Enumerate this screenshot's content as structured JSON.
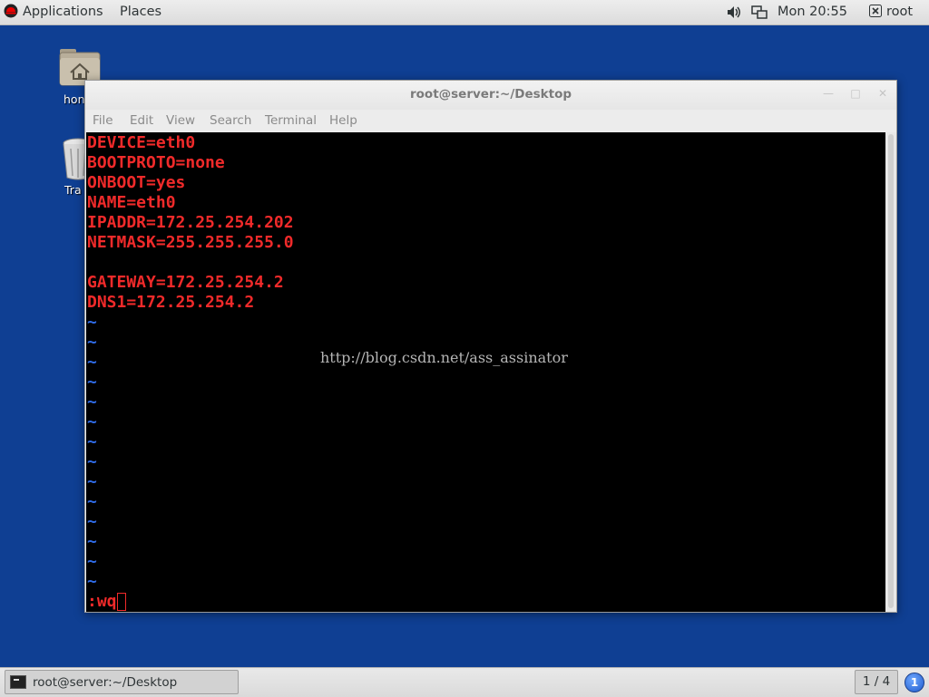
{
  "top_panel": {
    "applications_label": "Applications",
    "places_label": "Places",
    "clock": "Mon 20:55",
    "user": "root"
  },
  "desktop": {
    "home_label": "hon",
    "trash_label": "Tra"
  },
  "terminal": {
    "title": "root@server:~/Desktop",
    "menu": [
      "File",
      "Edit",
      "View",
      "Search",
      "Terminal",
      "Help"
    ],
    "lines": [
      "DEVICE=eth0",
      "BOOTPROTO=none",
      "ONBOOT=yes",
      "NAME=eth0",
      "IPADDR=172.25.254.202",
      "NETMASK=255.255.255.0",
      "",
      "GATEWAY=172.25.254.2",
      "DNS1=172.25.254.2"
    ],
    "tilde": "~",
    "command_line": ":wq",
    "watermark": "http://blog.csdn.net/ass_assinator"
  },
  "bottom_panel": {
    "task_label": "root@server:~/Desktop",
    "workspace": "1 / 4",
    "notification_count": "1"
  },
  "colors": {
    "desktop_bg": "#0f3f93",
    "terminal_text": "#f02a2a",
    "tilde": "#2f6be6"
  },
  "icons": [
    "redhat-logo-icon",
    "volume-icon",
    "network-icon",
    "user-icon",
    "home-folder-icon",
    "trash-icon",
    "terminal-icon"
  ]
}
